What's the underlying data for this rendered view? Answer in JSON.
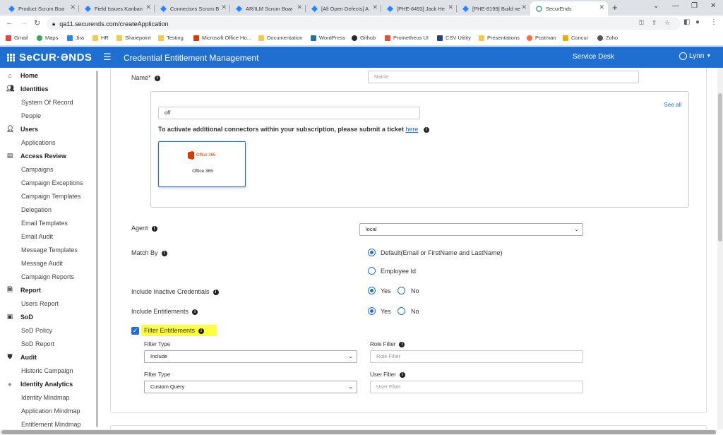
{
  "browser": {
    "tabs": [
      {
        "title": "Product Scrum Boa"
      },
      {
        "title": "Field Issues Kanban"
      },
      {
        "title": "Connectors Scrum B"
      },
      {
        "title": "AR/ILM Scrum Boar"
      },
      {
        "title": "[All Open Defects] A"
      },
      {
        "title": "[PHE-6493] Jack He"
      },
      {
        "title": "[PHE-8199] Build ne"
      },
      {
        "title": "SecurEnds"
      }
    ],
    "url": "qa11.securends.com/createApplication",
    "bookmarks": [
      "Gmail",
      "Maps",
      "Jira",
      "HR",
      "Sharepoint",
      "Testing",
      "Microsoft Office Ho...",
      "Documentation",
      "WordPress",
      "Github",
      "Prometheus UI",
      "CSV Utility",
      "Presentations",
      "Postman",
      "Concur",
      "Zoho"
    ]
  },
  "header": {
    "logo": "SeCUR·ƏNDS",
    "title": "Credential Entitlement Management",
    "service_desk": "Service Desk",
    "user": "Lynn"
  },
  "sidebar": {
    "items": [
      {
        "label": "Home",
        "top": true,
        "icon": "home-icon"
      },
      {
        "label": "Identities",
        "top": true,
        "icon": "identities-icon"
      },
      {
        "label": "System Of Record"
      },
      {
        "label": "People"
      },
      {
        "label": "Users",
        "top": true,
        "icon": "user-icon"
      },
      {
        "label": "Applications"
      },
      {
        "label": "Access Review",
        "top": true,
        "icon": "access-review-icon"
      },
      {
        "label": "Campaigns"
      },
      {
        "label": "Campaign Exceptions"
      },
      {
        "label": "Campaign Templates"
      },
      {
        "label": "Delegation"
      },
      {
        "label": "Email Templates"
      },
      {
        "label": "Email Audit"
      },
      {
        "label": "Message Templates"
      },
      {
        "label": "Message Audit"
      },
      {
        "label": "Campaign Reports"
      },
      {
        "label": "Report",
        "top": true,
        "icon": "report-icon"
      },
      {
        "label": "Users Report"
      },
      {
        "label": "SoD",
        "top": true,
        "icon": "sod-icon"
      },
      {
        "label": "SoD Policy"
      },
      {
        "label": "SoD Report"
      },
      {
        "label": "Audit",
        "top": true,
        "icon": "audit-icon"
      },
      {
        "label": "Historic Campaign"
      },
      {
        "label": "Identity Analytics",
        "top": true,
        "icon": "analytics-icon"
      },
      {
        "label": "Identity Mindmap"
      },
      {
        "label": "Application Mindmap"
      },
      {
        "label": "Entitlement Mindmap"
      }
    ]
  },
  "form": {
    "name_label": "Name*",
    "name_placeholder": "Name",
    "connector_search_value": "off",
    "see_all": "See all",
    "activate_text": "To activate additional connectors within your subscription, please submit a ticket",
    "activate_link": "here",
    "connector_tile": {
      "logo_text": "Office 365",
      "name": "Office 365"
    },
    "agent_label": "Agent",
    "agent_value": "local",
    "match_by_label": "Match By",
    "match_by_options": [
      {
        "label": "Default(Email or FirstName and LastName)",
        "selected": true
      },
      {
        "label": "Employee Id",
        "selected": false
      }
    ],
    "include_inactive_label": "Include Inactive Credentials",
    "include_inactive_options": [
      {
        "label": "Yes",
        "selected": true
      },
      {
        "label": "No",
        "selected": false
      }
    ],
    "include_entitlements_label": "Include Entitlements",
    "include_entitlements_options": [
      {
        "label": "Yes",
        "selected": true
      },
      {
        "label": "No",
        "selected": false
      }
    ],
    "filter_entitlements_label": "Filter Entitlements",
    "filter_entitlements_checked": true,
    "filter_type_label_1": "Filter Type",
    "filter_type_value_1": "Include",
    "role_filter_label": "Role Filter",
    "role_filter_placeholder": "Role Filter",
    "filter_type_label_2": "Filter Type",
    "filter_type_value_2": "Custom Query",
    "user_filter_label": "User Filter",
    "user_filter_placeholder": "User Filter"
  },
  "colors": {
    "brand_blue": "#1f6fd0",
    "highlight": "#ffff40",
    "office_orange": "#d83b01"
  }
}
